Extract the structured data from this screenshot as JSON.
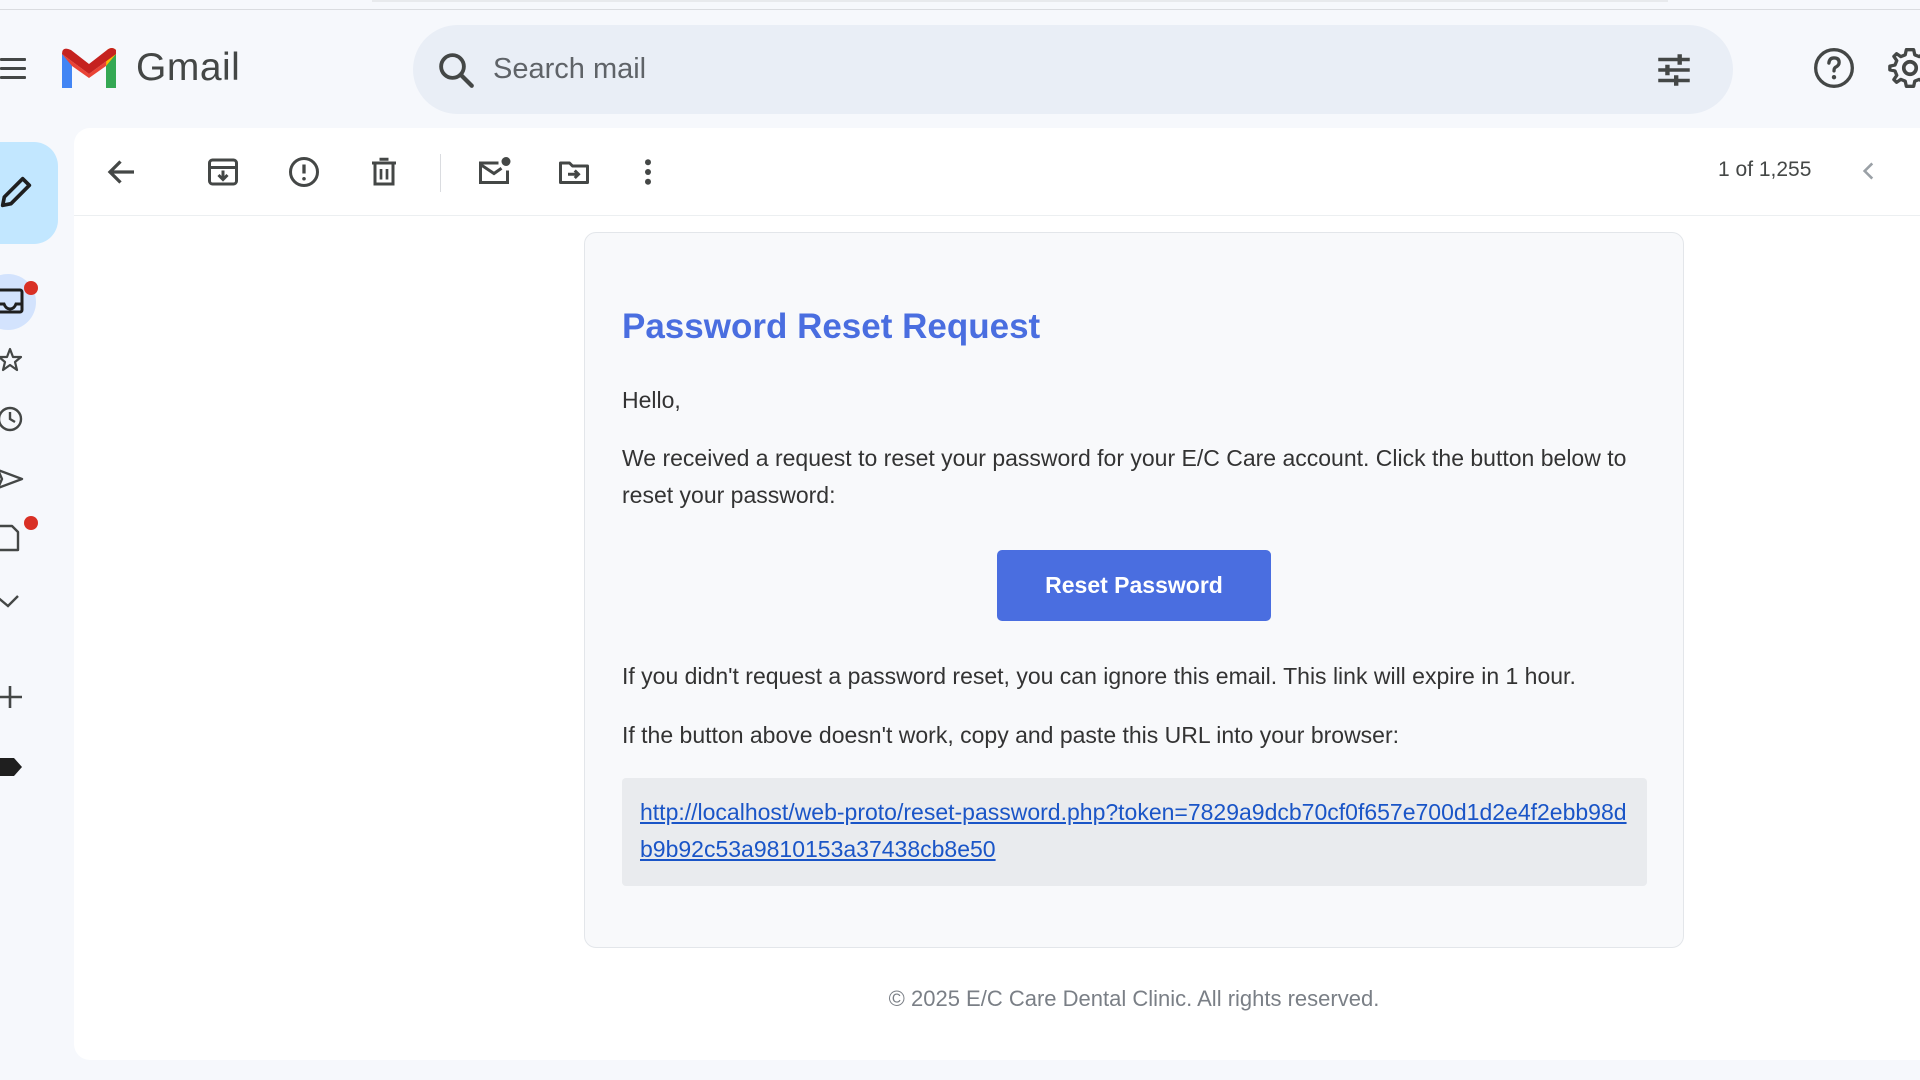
{
  "app": {
    "brand": "Gmail"
  },
  "search": {
    "placeholder": "Search mail"
  },
  "toolbar": {
    "pager": "1 of 1,255"
  },
  "email": {
    "title": "Password Reset Request",
    "greeting": "Hello,",
    "body1": "We received a request to reset your password for your E/C Care account. Click the button below to reset your password:",
    "button_label": "Reset Password",
    "body2": "If you didn't request a password reset, you can ignore this email. This link will expire in 1 hour.",
    "body3": "If the button above doesn't work, copy and paste this URL into your browser:",
    "url": "http://localhost/web-proto/reset-password.php?token=7829a9dcb70cf0f657e700d1d2e4f2ebb98db9b92c53a9810153a37438cb8e50",
    "footer": "© 2025 E/C Care Dental Clinic. All rights reserved."
  },
  "colors": {
    "accent": "#4a6ee0",
    "compose_bg": "#c2e7ff",
    "badge": "#d93025"
  },
  "icons": [
    "menu-icon",
    "gmail-logo-icon",
    "search-icon",
    "tune-icon",
    "help-icon",
    "gear-icon",
    "pencil-icon",
    "inbox-icon",
    "star-icon",
    "clock-icon",
    "send-icon",
    "draft-icon",
    "chevron-down-icon",
    "plus-icon",
    "label-icon",
    "back-arrow-icon",
    "archive-icon",
    "report-spam-icon",
    "trash-icon",
    "mark-unread-icon",
    "move-to-icon",
    "more-vert-icon",
    "chevron-left-icon"
  ]
}
